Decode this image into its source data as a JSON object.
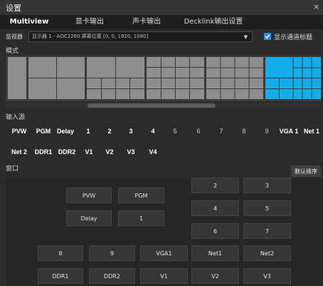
{
  "window": {
    "title": "设置",
    "close_glyph": "×"
  },
  "tabs": [
    {
      "label": "Multiview",
      "active": true
    },
    {
      "label": "显卡输出",
      "active": false
    },
    {
      "label": "声卡输出",
      "active": false
    },
    {
      "label": "Decklink输出设置",
      "active": false
    }
  ],
  "monitor": {
    "label": "监视器",
    "selected": "显示器 1 - AOC2260 屏幕位置 [0, 0, 1920, 1080]",
    "show_title_label": "显示通道标题",
    "show_title_checked": true
  },
  "mode": {
    "label": "模式",
    "selected_index": 5
  },
  "sources": {
    "label": "输入源",
    "items": [
      "PVW",
      "PGM",
      "Delay",
      "1",
      "2",
      "3",
      "4",
      "5",
      "6",
      "7",
      "8",
      "9",
      "VGA 1",
      "Net 1",
      "Net 2",
      "DDR1",
      "DDR2",
      "V1",
      "V2",
      "V3",
      "V4"
    ]
  },
  "window_section": {
    "label": "窗口",
    "default_order_label": "默认排序",
    "cells": [
      "PVW",
      "PGM",
      "Delay",
      "1",
      "2",
      "3",
      "4",
      "5",
      "6",
      "7",
      "8",
      "9",
      "VGA1",
      "Net1",
      "Net2",
      "DDR1",
      "DDR2",
      "V1",
      "V2",
      "V3"
    ]
  },
  "colors": {
    "accent": "#13aee9",
    "checkbox": "#2f8be0"
  }
}
